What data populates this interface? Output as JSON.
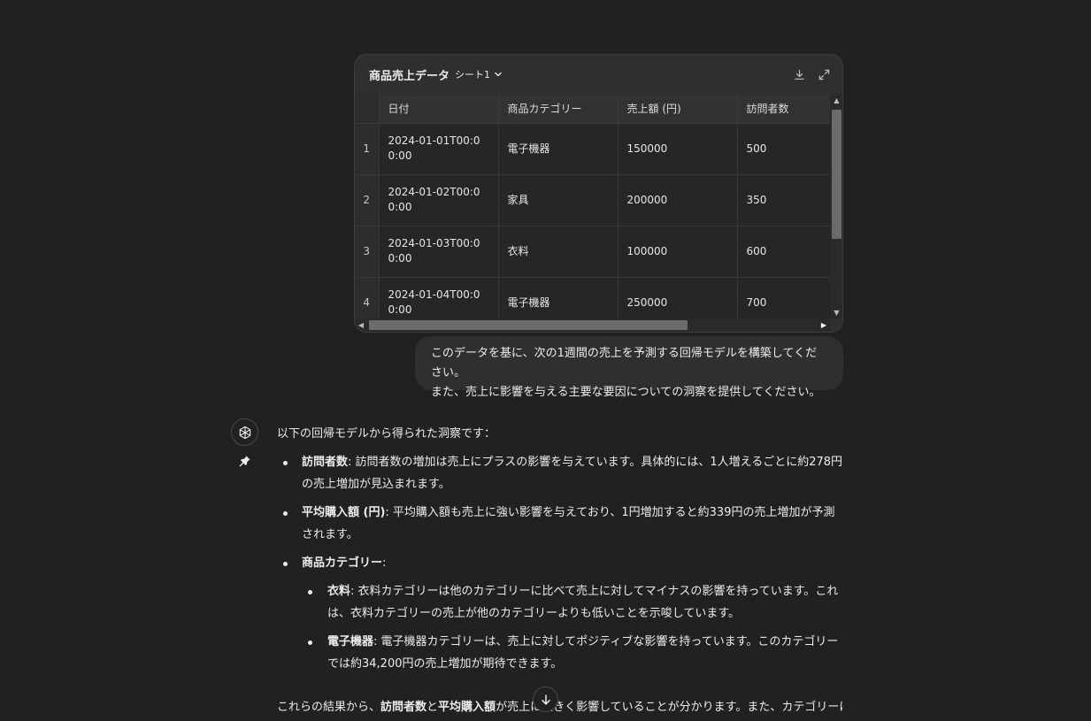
{
  "sheet": {
    "title": "商品売上データ",
    "tab_label": "シート1",
    "download_icon": "download-icon",
    "expand_icon": "expand-icon",
    "columns": [
      "日付",
      "商品カテゴリー",
      "売上額 (円)",
      "訪問者数"
    ],
    "rows": [
      {
        "num": "1",
        "date": "2024-01-01T00:00:00",
        "category": "電子機器",
        "sales": "150000",
        "visitors": "500"
      },
      {
        "num": "2",
        "date": "2024-01-02T00:00:00",
        "category": "家具",
        "sales": "200000",
        "visitors": "350"
      },
      {
        "num": "3",
        "date": "2024-01-03T00:00:00",
        "category": "衣料",
        "sales": "100000",
        "visitors": "600"
      },
      {
        "num": "4",
        "date": "2024-01-04T00:00:00",
        "category": "電子機器",
        "sales": "250000",
        "visitors": "700"
      }
    ]
  },
  "user_message": {
    "line1": "このデータを基に、次の1週間の売上を予測する回帰モデルを構築してください。",
    "line2": "また、売上に影響を与える主要な要因についての洞察を提供してください。"
  },
  "assistant": {
    "avatar_icon": "openai-logo-icon",
    "pin_icon": "pin-icon",
    "intro": "以下の回帰モデルから得られた洞察です：",
    "bullets": {
      "visitors_label": "訪問者数",
      "visitors_text": ": 訪問者数の増加は売上にプラスの影響を与えています。具体的には、1人増えるごとに約278円の売上増加が見込まれます。",
      "avg_label": "平均購入額 (円)",
      "avg_text": ": 平均購入額も売上に強い影響を与えており、1円増加すると約339円の売上増加が予測されます。",
      "category_label": "商品カテゴリー",
      "category_text": ":",
      "clothing_label": "衣料",
      "clothing_text": ": 衣料カテゴリーは他のカテゴリーに比べて売上に対してマイナスの影響を持っています。これは、衣料カテゴリーの売上が他のカテゴリーよりも低いことを示唆しています。",
      "electronics_label": "電子機器",
      "electronics_text": ": 電子機器カテゴリーは、売上に対してポジティブな影響を持っています。このカテゴリーでは約34,200円の売上増加が期待できます。"
    },
    "conclusion": {
      "part1": "これらの結果から、",
      "bold1": "訪問者数",
      "part2": "と",
      "bold2": "平均購入額",
      "part3": "が売上に大きく影響していることが分かります。また、カテゴリーによって"
    }
  },
  "scroll_button_icon": "arrow-down-icon"
}
